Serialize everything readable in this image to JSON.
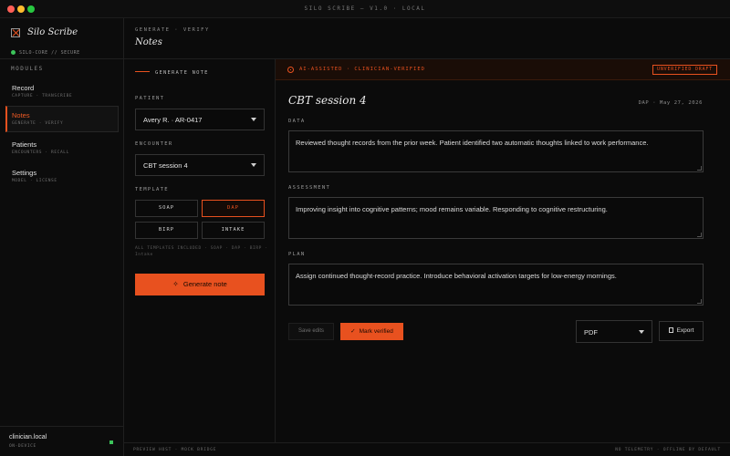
{
  "window": {
    "title": "SILO SCRIBE — V1.0 · LOCAL"
  },
  "sidebar": {
    "brand_name": "Silo Scribe",
    "brand_status": "SILO-CORE // SECURE",
    "heading": "MODULES",
    "items": [
      {
        "label": "Record",
        "sub": "CAPTURE · TRANSCRIBE"
      },
      {
        "label": "Notes",
        "sub": "GENERATE · VERIFY"
      },
      {
        "label": "Patients",
        "sub": "ENCOUNTERS · RECALL"
      },
      {
        "label": "Settings",
        "sub": "MODEL · LICENSE"
      }
    ],
    "user": {
      "name": "clinician.local",
      "sub": "ON-DEVICE"
    }
  },
  "header": {
    "breadcrumb": "GENERATE · VERIFY",
    "title": "Notes"
  },
  "form": {
    "section_title": "GENERATE NOTE",
    "patient_label": "PATIENT",
    "patient_value": "Avery R. · AR-0417",
    "encounter_label": "ENCOUNTER",
    "encounter_value": "CBT session 4",
    "template_label": "TEMPLATE",
    "templates": [
      "SOAP",
      "DAP",
      "BIRP",
      "INTAKE"
    ],
    "selected_template": "DAP",
    "templates_note": "ALL TEMPLATES INCLUDED · SOAP · DAP · BIRP · Intake",
    "generate_label": "Generate note"
  },
  "note": {
    "banner_text": "AI-ASSISTED · CLINICIAN-VERIFIED",
    "badge": "UNVERIFIED DRAFT",
    "title": "CBT session 4",
    "meta": "DAP · May 27, 2026",
    "sections": [
      {
        "label": "DATA",
        "text": "Reviewed thought records from the prior week. Patient identified two automatic thoughts linked to work performance."
      },
      {
        "label": "ASSESSMENT",
        "text": "Improving insight into cognitive patterns; mood remains variable. Responding to cognitive restructuring."
      },
      {
        "label": "PLAN",
        "text": "Assign continued thought-record practice. Introduce behavioral activation targets for low-energy mornings."
      }
    ],
    "save_label": "Save edits",
    "verify_label": "Mark verified",
    "format_value": "PDF",
    "export_label": "Export"
  },
  "footer": {
    "left": "PREVIEW HOST · MOCK BRIDGE",
    "right": "NO TELEMETRY · OFFLINE BY DEFAULT"
  },
  "colors": {
    "accent": "#e8511f",
    "status_ok": "#3cc45a",
    "background": "#0b0b0b"
  }
}
